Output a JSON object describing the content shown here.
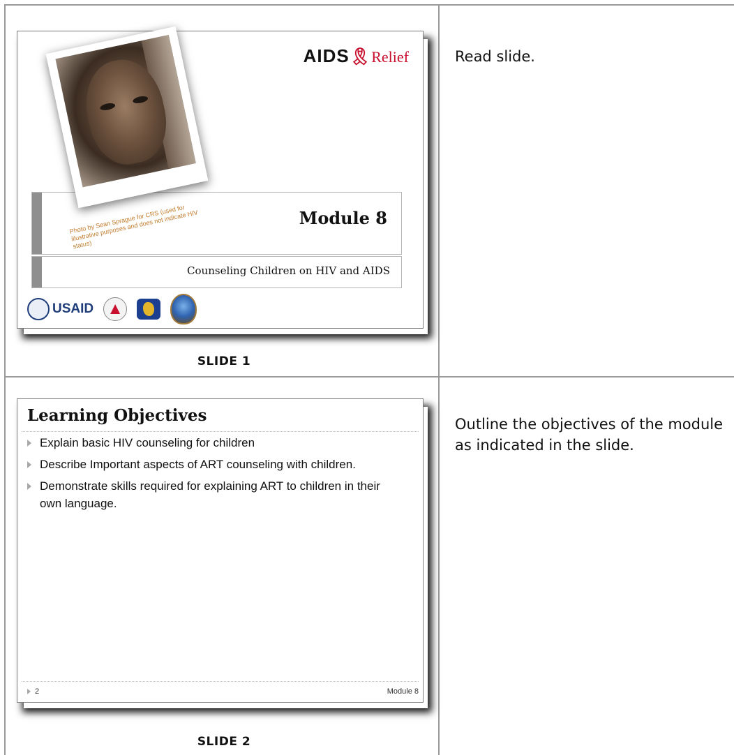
{
  "rows": [
    {
      "slide_caption": "Slide 1",
      "notes": "Read slide.",
      "slide": {
        "logo_text": "AIDS",
        "logo_relief": "Relief",
        "module_title": "Module 8",
        "subtitle": "Counseling Children on HIV and AIDS",
        "photo_credit": "Photo by Sean Sprague for CRS (used for illustrative purposes and does not indicate HIV status)",
        "partner_logo_text": "USAID"
      }
    },
    {
      "slide_caption": "Slide 2",
      "notes": "Outline the objectives of the module as indicated in the slide.",
      "slide": {
        "title": "Learning Objectives",
        "bullets": [
          "Explain basic HIV counseling for children",
          "Describe Important aspects of ART counseling with children.",
          "Demonstrate skills required for explaining ART to children in their own language."
        ],
        "page_number": "2",
        "footer": "Module 8"
      }
    }
  ]
}
